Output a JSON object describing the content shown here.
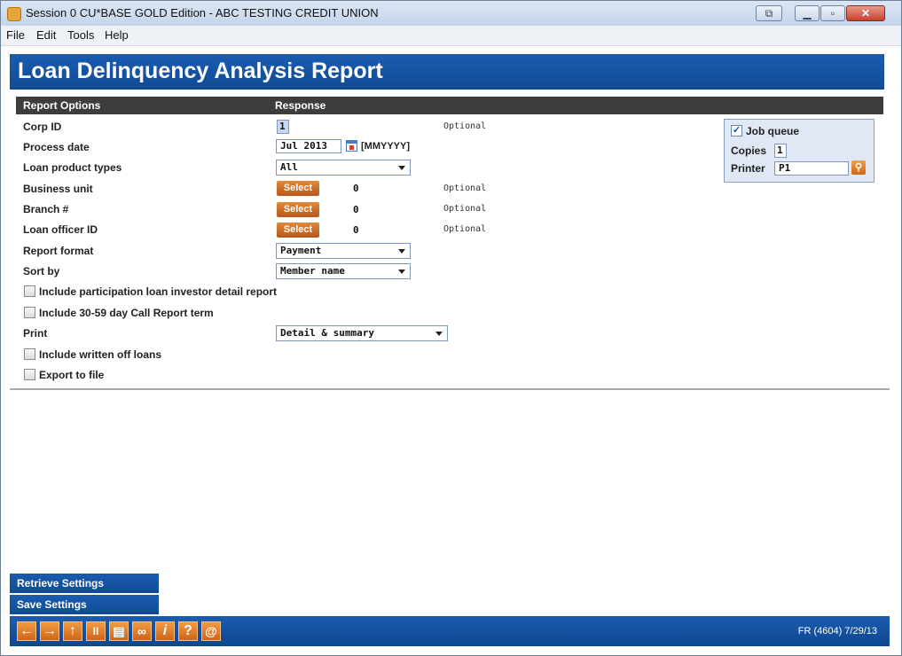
{
  "window": {
    "title": "Session 0 CU*BASE GOLD Edition - ABC TESTING CREDIT UNION",
    "controls": {
      "restore": "⧉",
      "minimize": "▁",
      "maximize": "▫",
      "close": "✕"
    }
  },
  "menu": [
    "File",
    "Edit",
    "Tools",
    "Help"
  ],
  "page_title": "Loan Delinquency Analysis Report",
  "table_header": {
    "options": "Report Options",
    "response": "Response"
  },
  "fields": {
    "corp_id": {
      "label": "Corp ID",
      "value": "1",
      "hint": "Optional"
    },
    "process_date": {
      "label": "Process date",
      "value": "Jul 2013",
      "format": "[MMYYYY]"
    },
    "loan_product_types": {
      "label": "Loan product types",
      "value": "All"
    },
    "business_unit": {
      "label": "Business unit",
      "button": "Select",
      "count": "0",
      "hint": "Optional"
    },
    "branch": {
      "label": "Branch #",
      "button": "Select",
      "count": "0",
      "hint": "Optional"
    },
    "loan_officer": {
      "label": "Loan officer ID",
      "button": "Select",
      "count": "0",
      "hint": "Optional"
    },
    "report_format": {
      "label": "Report format",
      "value": "Payment"
    },
    "sort_by": {
      "label": "Sort by",
      "value": "Member name"
    },
    "include_participation": {
      "label": "Include participation loan investor detail report",
      "checked": false
    },
    "include_call_report": {
      "label": "Include 30-59 day Call Report term",
      "checked": false
    },
    "print": {
      "label": "Print",
      "value": "Detail & summary"
    },
    "include_written_off": {
      "label": "Include written off loans",
      "checked": false
    },
    "export_to_file": {
      "label": "Export to file",
      "checked": false
    }
  },
  "job_queue": {
    "label": "Job queue",
    "checked": true,
    "copies_label": "Copies",
    "copies": "1",
    "printer_label": "Printer",
    "printer": "P1"
  },
  "side_buttons": {
    "retrieve": "Retrieve Settings",
    "save": "Save Settings"
  },
  "nav_icons": [
    {
      "name": "back-arrow-icon",
      "glyph": "←"
    },
    {
      "name": "forward-arrow-icon",
      "glyph": "→"
    },
    {
      "name": "up-arrow-icon",
      "glyph": "↑"
    },
    {
      "name": "pause-icon",
      "glyph": "II"
    },
    {
      "name": "print-icon",
      "glyph": "▤"
    },
    {
      "name": "link-icon",
      "glyph": "∞"
    },
    {
      "name": "info-icon",
      "glyph": "i"
    },
    {
      "name": "help-icon",
      "glyph": "?"
    },
    {
      "name": "at-sign-icon",
      "glyph": "@"
    }
  ],
  "status": "FR (4604) 7/29/13",
  "colors": {
    "banner": "#1b5cb0",
    "accent_orange": "#d8782a",
    "header_dark": "#3d3d3d"
  }
}
